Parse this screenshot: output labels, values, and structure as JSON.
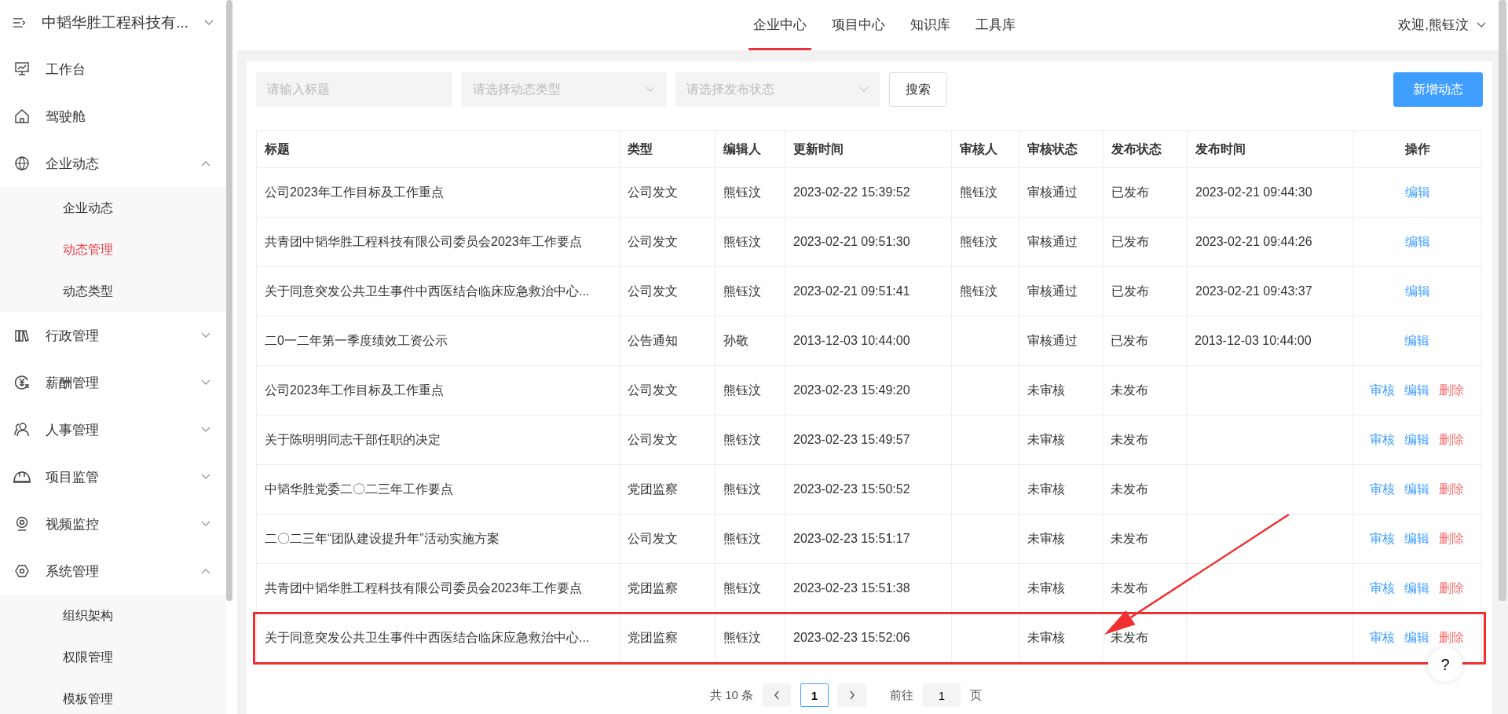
{
  "sidebar": {
    "company": "中韬华胜工程科技有...",
    "items": [
      {
        "label": "工作台"
      },
      {
        "label": "驾驶舱"
      },
      {
        "label": "企业动态",
        "expanded": true,
        "children": [
          {
            "label": "企业动态",
            "selected": false
          },
          {
            "label": "动态管理",
            "selected": true
          },
          {
            "label": "动态类型",
            "selected": false
          }
        ]
      },
      {
        "label": "行政管理",
        "expanded": false
      },
      {
        "label": "薪酬管理",
        "expanded": false
      },
      {
        "label": "人事管理",
        "expanded": false
      },
      {
        "label": "项目监管",
        "expanded": false
      },
      {
        "label": "视频监控",
        "expanded": false
      },
      {
        "label": "系统管理",
        "expanded": true,
        "children": [
          {
            "label": "组织架构",
            "selected": false
          },
          {
            "label": "权限管理",
            "selected": false
          },
          {
            "label": "模板管理",
            "selected": false
          }
        ]
      }
    ]
  },
  "top_nav": {
    "tabs": [
      {
        "label": "企业中心",
        "selected": true
      },
      {
        "label": "项目中心",
        "selected": false
      },
      {
        "label": "知识库",
        "selected": false
      },
      {
        "label": "工具库",
        "selected": false
      }
    ],
    "user": "欢迎,熊钰汶"
  },
  "filters": {
    "title_placeholder": "请输入标题",
    "type_placeholder": "请选择动态类型",
    "status_placeholder": "请选择发布状态",
    "search": "搜索",
    "add": "新增动态"
  },
  "table": {
    "columns": [
      "标题",
      "类型",
      "编辑人",
      "更新时间",
      "审核人",
      "审核状态",
      "发布状态",
      "发布时间",
      "操作"
    ],
    "rows": [
      {
        "cells": [
          "公司2023年工作目标及工作重点",
          "公司发文",
          "熊钰汶",
          "2023-02-22 15:39:52",
          "熊钰汶",
          "审核通过",
          "已发布",
          "2023-02-21 09:44:30"
        ],
        "actions": [
          {
            "label": "编辑",
            "kind": "edit"
          }
        ],
        "highlighted": false
      },
      {
        "cells": [
          "共青团中韬华胜工程科技有限公司委员会2023年工作要点",
          "公司发文",
          "熊钰汶",
          "2023-02-21 09:51:30",
          "熊钰汶",
          "审核通过",
          "已发布",
          "2023-02-21 09:44:26"
        ],
        "actions": [
          {
            "label": "编辑",
            "kind": "edit"
          }
        ],
        "highlighted": false
      },
      {
        "cells": [
          "关于同意突发公共卫生事件中西医结合临床应急救治中心...",
          "公司发文",
          "熊钰汶",
          "2023-02-21 09:51:41",
          "熊钰汶",
          "审核通过",
          "已发布",
          "2023-02-21 09:43:37"
        ],
        "actions": [
          {
            "label": "编辑",
            "kind": "edit"
          }
        ],
        "highlighted": false
      },
      {
        "cells": [
          "二0一二年第一季度绩效工资公示",
          "公告通知",
          "孙敬",
          "2013-12-03 10:44:00",
          "",
          "审核通过",
          "已发布",
          "2013-12-03 10:44:00"
        ],
        "actions": [
          {
            "label": "编辑",
            "kind": "edit"
          }
        ],
        "highlighted": false
      },
      {
        "cells": [
          "公司2023年工作目标及工作重点",
          "公司发文",
          "熊钰汶",
          "2023-02-23 15:49:20",
          "",
          "未审核",
          "未发布",
          ""
        ],
        "actions": [
          {
            "label": "审核",
            "kind": "review"
          },
          {
            "label": "编辑",
            "kind": "edit"
          },
          {
            "label": "删除",
            "kind": "delete"
          }
        ],
        "highlighted": false
      },
      {
        "cells": [
          "关于陈明明同志干部任职的决定",
          "公司发文",
          "熊钰汶",
          "2023-02-23 15:49:57",
          "",
          "未审核",
          "未发布",
          ""
        ],
        "actions": [
          {
            "label": "审核",
            "kind": "review"
          },
          {
            "label": "编辑",
            "kind": "edit"
          },
          {
            "label": "删除",
            "kind": "delete"
          }
        ],
        "highlighted": false
      },
      {
        "cells": [
          "中韬华胜党委二〇二三年工作要点",
          "党团监察",
          "熊钰汶",
          "2023-02-23 15:50:52",
          "",
          "未审核",
          "未发布",
          ""
        ],
        "actions": [
          {
            "label": "审核",
            "kind": "review"
          },
          {
            "label": "编辑",
            "kind": "edit"
          },
          {
            "label": "删除",
            "kind": "delete"
          }
        ],
        "highlighted": false
      },
      {
        "cells": [
          "二〇二三年“团队建设提升年”活动实施方案",
          "公司发文",
          "熊钰汶",
          "2023-02-23 15:51:17",
          "",
          "未审核",
          "未发布",
          ""
        ],
        "actions": [
          {
            "label": "审核",
            "kind": "review"
          },
          {
            "label": "编辑",
            "kind": "edit"
          },
          {
            "label": "删除",
            "kind": "delete"
          }
        ],
        "highlighted": false
      },
      {
        "cells": [
          "共青团中韬华胜工程科技有限公司委员会2023年工作要点",
          "党团监察",
          "熊钰汶",
          "2023-02-23 15:51:38",
          "",
          "未审核",
          "未发布",
          ""
        ],
        "actions": [
          {
            "label": "审核",
            "kind": "review"
          },
          {
            "label": "编辑",
            "kind": "edit"
          },
          {
            "label": "删除",
            "kind": "delete"
          }
        ],
        "highlighted": false
      },
      {
        "cells": [
          "关于同意突发公共卫生事件中西医结合临床应急救治中心...",
          "党团监察",
          "熊钰汶",
          "2023-02-23 15:52:06",
          "",
          "未审核",
          "未发布",
          ""
        ],
        "actions": [
          {
            "label": "审核",
            "kind": "review"
          },
          {
            "label": "编辑",
            "kind": "edit"
          },
          {
            "label": "删除",
            "kind": "delete"
          }
        ],
        "highlighted": true
      }
    ]
  },
  "pagination": {
    "total": "共 10 条",
    "pages": [
      {
        "label": "1",
        "selected": true
      }
    ],
    "goto": "前往",
    "goto_value": "1",
    "page_unit": "页"
  },
  "help": "?"
}
